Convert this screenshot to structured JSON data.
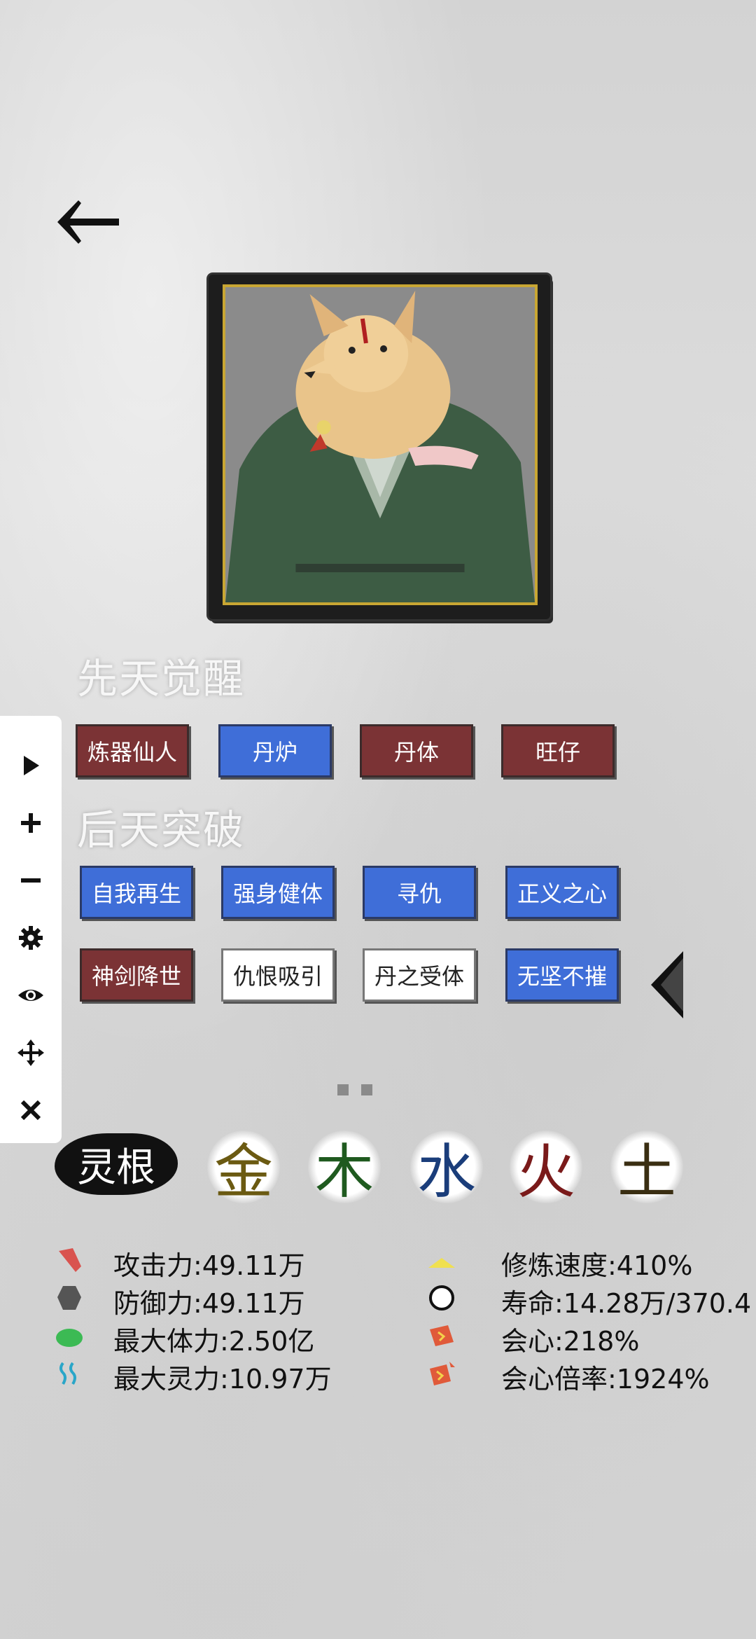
{
  "header": {
    "back_icon": "back-arrow-icon"
  },
  "innate": {
    "title": "先天觉醒",
    "traits": [
      {
        "label": "炼器仙人",
        "style": "red"
      },
      {
        "label": "丹炉",
        "style": "blue"
      },
      {
        "label": "丹体",
        "style": "red"
      },
      {
        "label": "旺仔",
        "style": "red"
      }
    ]
  },
  "acquired": {
    "title": "后天突破",
    "traits": [
      {
        "label": "自我再生",
        "style": "blue"
      },
      {
        "label": "强身健体",
        "style": "blue"
      },
      {
        "label": "寻仇",
        "style": "blue"
      },
      {
        "label": "正义之心",
        "style": "blue"
      },
      {
        "label": "神剑降世",
        "style": "red"
      },
      {
        "label": "仇恨吸引",
        "style": "white"
      },
      {
        "label": "丹之受体",
        "style": "white"
      },
      {
        "label": "无坚不摧",
        "style": "blue"
      }
    ]
  },
  "toolbar": {
    "tools": [
      "play-icon",
      "plus-icon",
      "minus-icon",
      "gear-icon",
      "eye-icon",
      "move-icon",
      "close-icon"
    ]
  },
  "pager": {
    "pages": 2
  },
  "spirit_root": {
    "label": "灵根",
    "elements": [
      {
        "char": "金",
        "color": "#6b5a12"
      },
      {
        "char": "木",
        "color": "#1f5a1f"
      },
      {
        "char": "水",
        "color": "#1a3d7a"
      },
      {
        "char": "火",
        "color": "#7a1a1a"
      },
      {
        "char": "土",
        "color": "#3a2e12"
      }
    ]
  },
  "stats_left": [
    {
      "label": "攻击力:49.11万",
      "icon": "attack-icon",
      "color": "#d9534f"
    },
    {
      "label": "防御力:49.11万",
      "icon": "defense-icon",
      "color": "#555555"
    },
    {
      "label": "最大体力:2.50亿",
      "icon": "health-icon",
      "color": "#3cba54"
    },
    {
      "label": "最大灵力:10.97万",
      "icon": "spirit-icon",
      "color": "#2aa6c8"
    }
  ],
  "stats_right": [
    {
      "label": "修炼速度:410%",
      "icon": "cultivation-speed-icon",
      "color": "#f0e050"
    },
    {
      "label": "寿命:14.28万/370.4",
      "icon": "lifespan-icon",
      "color": "#111111"
    },
    {
      "label": "会心:218%",
      "icon": "critical-icon",
      "color": "#e05a3a"
    },
    {
      "label": "会心倍率:1924%",
      "icon": "critical-rate-icon",
      "color": "#e05a3a"
    }
  ]
}
